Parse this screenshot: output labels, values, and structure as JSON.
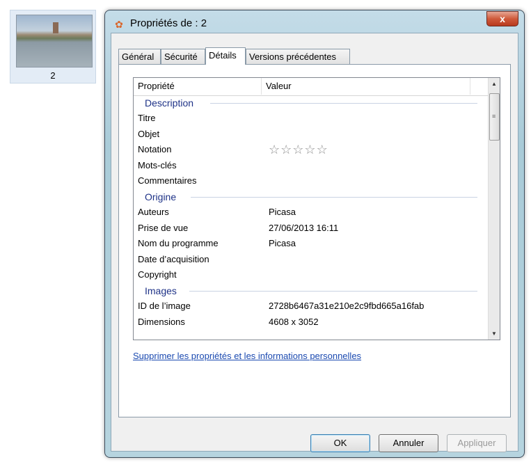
{
  "thumbnail": {
    "label": "2"
  },
  "window": {
    "title": "Propriétés de : 2",
    "close_label": "x"
  },
  "tabs": [
    {
      "label": "Général"
    },
    {
      "label": "Sécurité"
    },
    {
      "label": "Détails"
    },
    {
      "label": "Versions précédentes"
    }
  ],
  "active_tab": "Détails",
  "list": {
    "headers": {
      "property": "Propriété",
      "value": "Valeur"
    },
    "groups": [
      {
        "name": "Description",
        "rows": [
          {
            "key": "Titre",
            "value": ""
          },
          {
            "key": "Objet",
            "value": ""
          },
          {
            "key": "Notation",
            "value": "",
            "rating_stars": 0,
            "rating_max": 5
          },
          {
            "key": "Mots-clés",
            "value": ""
          },
          {
            "key": "Commentaires",
            "value": ""
          }
        ]
      },
      {
        "name": "Origine",
        "rows": [
          {
            "key": "Auteurs",
            "value": "Picasa"
          },
          {
            "key": "Prise de vue",
            "value": "27/06/2013 16:11"
          },
          {
            "key": "Nom du programme",
            "value": "Picasa"
          },
          {
            "key": "Date d’acquisition",
            "value": ""
          },
          {
            "key": "Copyright",
            "value": ""
          }
        ]
      },
      {
        "name": "Images",
        "rows": [
          {
            "key": "ID de l’image",
            "value": "2728b6467a31e210e2c9fbd665a16fab"
          },
          {
            "key": "Dimensions",
            "value": "4608 x 3052"
          }
        ]
      }
    ]
  },
  "link_text": "Supprimer les propriétés et les informations personnelles",
  "buttons": {
    "ok": "OK",
    "cancel": "Annuler",
    "apply": "Appliquer"
  }
}
